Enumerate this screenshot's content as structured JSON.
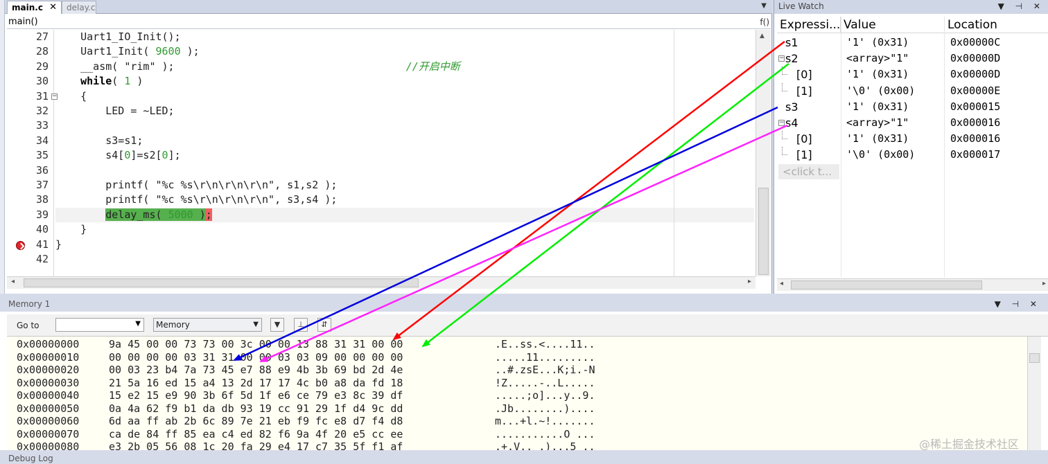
{
  "editor": {
    "tabs": [
      {
        "label": "main.c",
        "close": "✕"
      },
      {
        "label": "delay.c"
      }
    ],
    "function_scope": "main()",
    "function_icon": "f()",
    "lines": [
      {
        "n": "27",
        "segs": [
          {
            "t": "    Uart1_IO_Init();"
          }
        ]
      },
      {
        "n": "28",
        "segs": [
          {
            "t": "    Uart1_Init( "
          },
          {
            "t": "9600",
            "c": "num"
          },
          {
            "t": " );"
          }
        ]
      },
      {
        "n": "29",
        "segs": [
          {
            "t": "    __asm( \"rim\" );                                     "
          },
          {
            "t": "//开启中断",
            "c": "cm"
          }
        ]
      },
      {
        "n": "30",
        "segs": [
          {
            "t": "    "
          },
          {
            "t": "while",
            "c": "kw"
          },
          {
            "t": "( "
          },
          {
            "t": "1",
            "c": "num"
          },
          {
            "t": " )"
          }
        ]
      },
      {
        "n": "31",
        "segs": [
          {
            "t": "    {"
          }
        ]
      },
      {
        "n": "32",
        "segs": [
          {
            "t": "        LED = ~LED;"
          }
        ]
      },
      {
        "n": "33",
        "segs": [
          {
            "t": ""
          }
        ]
      },
      {
        "n": "34",
        "segs": [
          {
            "t": "        s3=s1;"
          }
        ]
      },
      {
        "n": "35",
        "segs": [
          {
            "t": "        s4["
          },
          {
            "t": "0",
            "c": "num"
          },
          {
            "t": "]=s2["
          },
          {
            "t": "0",
            "c": "num"
          },
          {
            "t": "];"
          }
        ]
      },
      {
        "n": "36",
        "segs": [
          {
            "t": ""
          }
        ]
      },
      {
        "n": "37",
        "segs": [
          {
            "t": "        printf( \"%c %s\\r\\n\\r\\n\\r\\n\", s1,s2 );"
          }
        ]
      },
      {
        "n": "38",
        "segs": [
          {
            "t": "        printf( \"%c %s\\r\\n\\r\\n\\r\\n\", s3,s4 );"
          }
        ]
      },
      {
        "n": "39",
        "segs": [
          {
            "t": "        "
          },
          {
            "t": "delay_ms( ",
            "c": "hl"
          },
          {
            "t": "5000",
            "c": "hl num"
          },
          {
            "t": " )",
            "c": "hl"
          },
          {
            "t": ";",
            "c": "hlr"
          }
        ]
      },
      {
        "n": "40",
        "segs": [
          {
            "t": "    }"
          }
        ]
      },
      {
        "n": "41",
        "segs": [
          {
            "t": "}"
          }
        ]
      },
      {
        "n": "42",
        "segs": [
          {
            "t": ""
          }
        ]
      }
    ],
    "breakpoint_line": "39"
  },
  "watch": {
    "title": "Live Watch",
    "title_buttons": "▼ ⊣ ✕",
    "headers": {
      "expression": "Expressi...",
      "value": "Value",
      "location": "Location"
    },
    "rows": [
      {
        "expr": "s1",
        "value": "'1' (0x31)",
        "loc": "0x00000C",
        "kind": "top"
      },
      {
        "expr": "s2",
        "value": "<array>\"1\"",
        "loc": "0x00000D",
        "kind": "expand",
        "pm": "⊟"
      },
      {
        "expr": "[0]",
        "value": "'1' (0x31)",
        "loc": "0x00000D",
        "kind": "child"
      },
      {
        "expr": "[1]",
        "value": "'\\0' (0x00)",
        "loc": "0x00000E",
        "kind": "child"
      },
      {
        "expr": "s3",
        "value": "'1' (0x31)",
        "loc": "0x000015",
        "kind": "top"
      },
      {
        "expr": "s4",
        "value": "<array>\"1\"",
        "loc": "0x000016",
        "kind": "expand",
        "pm": "⊟"
      },
      {
        "expr": "[0]",
        "value": "'1' (0x31)",
        "loc": "0x000016",
        "kind": "child"
      },
      {
        "expr": "[1]",
        "value": "'\\0' (0x00)",
        "loc": "0x000017",
        "kind": "child"
      }
    ],
    "click_placeholder": "<click t..."
  },
  "memory": {
    "title": "Memory 1",
    "title_buttons": "▼ ⊣ ✕",
    "goto_label": "Go to",
    "goto_value": "",
    "zone_select": "Memory",
    "rows": [
      {
        "addr": "0x00000000",
        "bytes": "9a 45 00 00 73 73 00 3c 00 00 13 88 31 31 00 00",
        "ascii": ".E..ss.<....11.."
      },
      {
        "addr": "0x00000010",
        "bytes": "00 00 00 00 03 31 31 00 00 03 03 09 00 00 00 00",
        "ascii": ".....11........."
      },
      {
        "addr": "0x00000020",
        "bytes": "00 03 23 b4 7a 73 45 e7 88 e9 4b 3b 69 bd 2d 4e",
        "ascii": "..#.zsE...K;i.-N"
      },
      {
        "addr": "0x00000030",
        "bytes": "21 5a 16 ed 15 a4 13 2d 17 17 4c b0 a8 da fd 18",
        "ascii": "!Z.....-..L....."
      },
      {
        "addr": "0x00000040",
        "bytes": "15 e2 15 e9 90 3b 6f 5d 1f e6 ce 79 e3 8c 39 df",
        "ascii": ".....;o]...y..9."
      },
      {
        "addr": "0x00000050",
        "bytes": "0a 4a 62 f9 b1 da db 93 19 cc 91 29 1f d4 9c dd",
        "ascii": ".Jb........)...."
      },
      {
        "addr": "0x00000060",
        "bytes": "6d aa ff ab 2b 6c 89 7e 21 eb f9 fc e8 d7 f4 d8",
        "ascii": "m...+l.~!......."
      },
      {
        "addr": "0x00000070",
        "bytes": "ca de 84 ff 85 ea c4 ed 82 f6 9a 4f 20 e5 cc ee",
        "ascii": "...........O ..."
      },
      {
        "addr": "0x00000080",
        "bytes": "e3 2b 05 56 08 1c 20 fa 29 e4 17 c7 35 5f f1 af",
        "ascii": ".+.V.. .)...5_.."
      }
    ]
  },
  "debug_log": {
    "title": "Debug Log"
  },
  "watermark": "@稀土掘金技术社区",
  "annotations": [
    {
      "name": "s1-arrow",
      "color": "#ff0000"
    },
    {
      "name": "s2-arrow",
      "color": "#00ee00"
    },
    {
      "name": "s3-arrow",
      "color": "#0000dd"
    },
    {
      "name": "s4-arrow",
      "color": "#ff22ff"
    }
  ]
}
